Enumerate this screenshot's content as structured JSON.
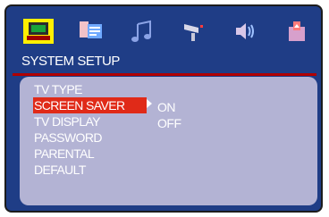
{
  "toolbar": {
    "icons": [
      "system-setup-icon",
      "language-setup-icon",
      "audio-setup-icon",
      "video-setup-icon",
      "speaker-setup-icon",
      "exit-icon"
    ]
  },
  "header": {
    "title": "SYSTEM SETUP"
  },
  "menu": {
    "items": [
      {
        "label": "TV TYPE",
        "selected": false
      },
      {
        "label": "SCREEN SAVER",
        "selected": true
      },
      {
        "label": "TV DISPLAY",
        "selected": false
      },
      {
        "label": "PASSWORD",
        "selected": false
      },
      {
        "label": "PARENTAL",
        "selected": false
      },
      {
        "label": "DEFAULT",
        "selected": false
      }
    ]
  },
  "options": {
    "items": [
      "ON",
      "OFF"
    ]
  },
  "colors": {
    "frame": "#1f3d86",
    "panel": "#b3b3d4",
    "highlight": "#e02a18",
    "title_rule": "#b00000",
    "text": "#ffffff"
  }
}
